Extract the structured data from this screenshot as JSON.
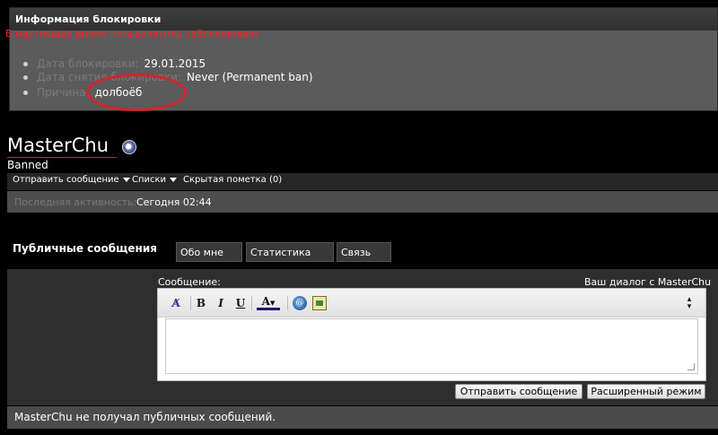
{
  "ban_info": {
    "header": "Информация блокировки",
    "status": "В настоящее время пользователь заблокирован",
    "rows": [
      {
        "label": "Дата блокировки:",
        "value": "29.01.2015"
      },
      {
        "label": "Дата снятия блокировки:",
        "value": "Never (Permanent ban)"
      },
      {
        "label": "Причина:",
        "value": "долбоёб"
      }
    ]
  },
  "profile": {
    "username": "MasterChu",
    "rank": "Banned",
    "actions": [
      "Отправить сообщение",
      "Списки",
      "Скрытая пометка (0)"
    ],
    "activity_label": "Последняя активность:",
    "activity_value": "Сегодня 02:44"
  },
  "tabs": [
    "Публичные сообщения",
    "Обо мне",
    "Статистика",
    "Связь"
  ],
  "composer": {
    "message_label": "Сообщение:",
    "dialog_label": "Ваш диалог с MasterChu",
    "toolbar": [
      "remove-format-icon",
      "bold-icon",
      "italic-icon",
      "underline-icon",
      "font-color-icon",
      "link-icon",
      "image-icon"
    ],
    "send_button": "Отправить сообщение",
    "advanced_button": "Расширенный режим"
  },
  "footer": "MasterChu не получал публичных сообщений.",
  "colors": {
    "accent_red": "#d8232a",
    "status_red": "#ff2020"
  }
}
